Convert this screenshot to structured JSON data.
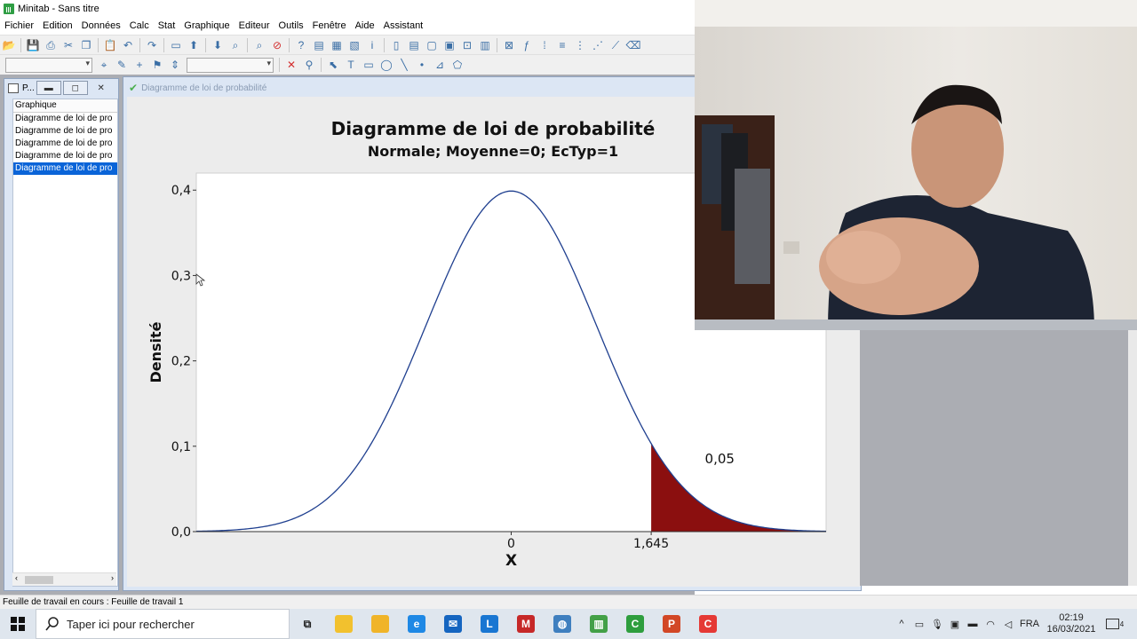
{
  "window": {
    "title": "Minitab - Sans titre"
  },
  "menu": [
    "Fichier",
    "Edition",
    "Données",
    "Calc",
    "Stat",
    "Graphique",
    "Editeur",
    "Outils",
    "Fenêtre",
    "Aide",
    "Assistant"
  ],
  "toolbar1_icons": [
    "open-icon",
    "save-icon",
    "print-icon",
    "cut-icon",
    "copy-icon",
    "paste-icon",
    "undo-icon",
    "redo-icon",
    "window-icon",
    "arrow-up-icon",
    "arrow-down-icon",
    "find-icon",
    "find-replace-icon",
    "cancel-icon",
    "help-icon",
    "session-icon",
    "worksheets-icon",
    "graphs-icon",
    "info-icon",
    "history-icon",
    "report-icon",
    "new-graph-icon",
    "edit-graph-icon",
    "related-icon",
    "layout-icon",
    "close-graphs-icon",
    "fx-icon",
    "brush-icon",
    "layers-icon",
    "graph-tools-icon",
    "scatter-icon",
    "regress-icon",
    "eraser-icon"
  ],
  "toolbar2_icons": [
    "brush-select-icon",
    "annotate-icon",
    "crosshair-icon",
    "flag-icon",
    "set-id-icon",
    "delete-icon",
    "zoom-icon",
    "select-icon",
    "text-icon",
    "rectangle-icon",
    "ellipse-icon",
    "line-icon",
    "point-icon",
    "polyline-icon",
    "polygon-icon"
  ],
  "project_manager": {
    "title": "P...",
    "header": "Graphique",
    "items": [
      "Diagramme de loi de pro",
      "Diagramme de loi de pro",
      "Diagramme de loi de pro",
      "Diagramme de loi de pro",
      "Diagramme de loi de pro"
    ],
    "selected_index": 4
  },
  "graph_window": {
    "title": "Diagramme de loi de probabilité"
  },
  "chart_data": {
    "type": "area",
    "title": "Diagramme de loi de probabilité",
    "subtitle": "Normale; Moyenne=0; EcTyp=1",
    "xlabel": "X",
    "ylabel": "Densité",
    "distribution": "normal",
    "mean": 0,
    "sd": 1,
    "xlim": [
      -3.7,
      3.7
    ],
    "ylim": [
      0,
      0.42
    ],
    "yticks": [
      "0,0",
      "0,1",
      "0,2",
      "0,3",
      "0,4"
    ],
    "ytick_values": [
      0,
      0.1,
      0.2,
      0.3,
      0.4
    ],
    "xticks": [
      "0",
      "1,645"
    ],
    "xtick_values": [
      0,
      1.645
    ],
    "shaded_region": {
      "from": 1.645,
      "to": 3.7,
      "probability_label": "0,05",
      "color": "#8b0f0f"
    },
    "curve_color": "#1f3f8f"
  },
  "status_bar": {
    "text": "Feuille de travail en cours : Feuille de travail 1"
  },
  "taskbar": {
    "search_placeholder": "Taper ici pour rechercher",
    "apps": [
      "task-view-icon",
      "sticky-notes-icon",
      "file-explorer-icon",
      "edge-icon",
      "mail-icon",
      "l-app-icon",
      "mcafee-icon",
      "globe-icon",
      "minitab-icon",
      "camtasia-icon",
      "powerpoint-icon",
      "camtasia-recorder-icon"
    ],
    "language": "FRA",
    "time": "02:19",
    "date": "16/03/2021",
    "notification_count": "4"
  }
}
